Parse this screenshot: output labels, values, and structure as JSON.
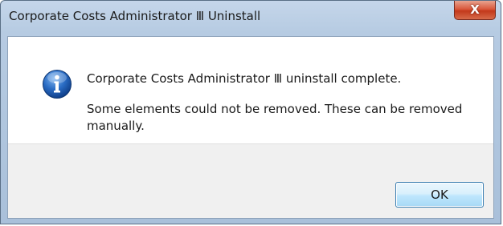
{
  "window": {
    "title": "Corporate Costs Administrator Ⅲ Uninstall",
    "close_glyph": "X"
  },
  "message": {
    "icon": "info-icon",
    "main": "Corporate Costs Administrator Ⅲ uninstall complete.",
    "sub": "Some elements could not be removed. These can be removed manually."
  },
  "buttons": {
    "ok_label": "OK"
  },
  "colors": {
    "titlebar": "#b6cbe2",
    "close_button": "#c3391b",
    "info_icon": "#1f5fb4",
    "footer": "#f0f0f0",
    "ok_button_border": "#3c7fb1"
  }
}
